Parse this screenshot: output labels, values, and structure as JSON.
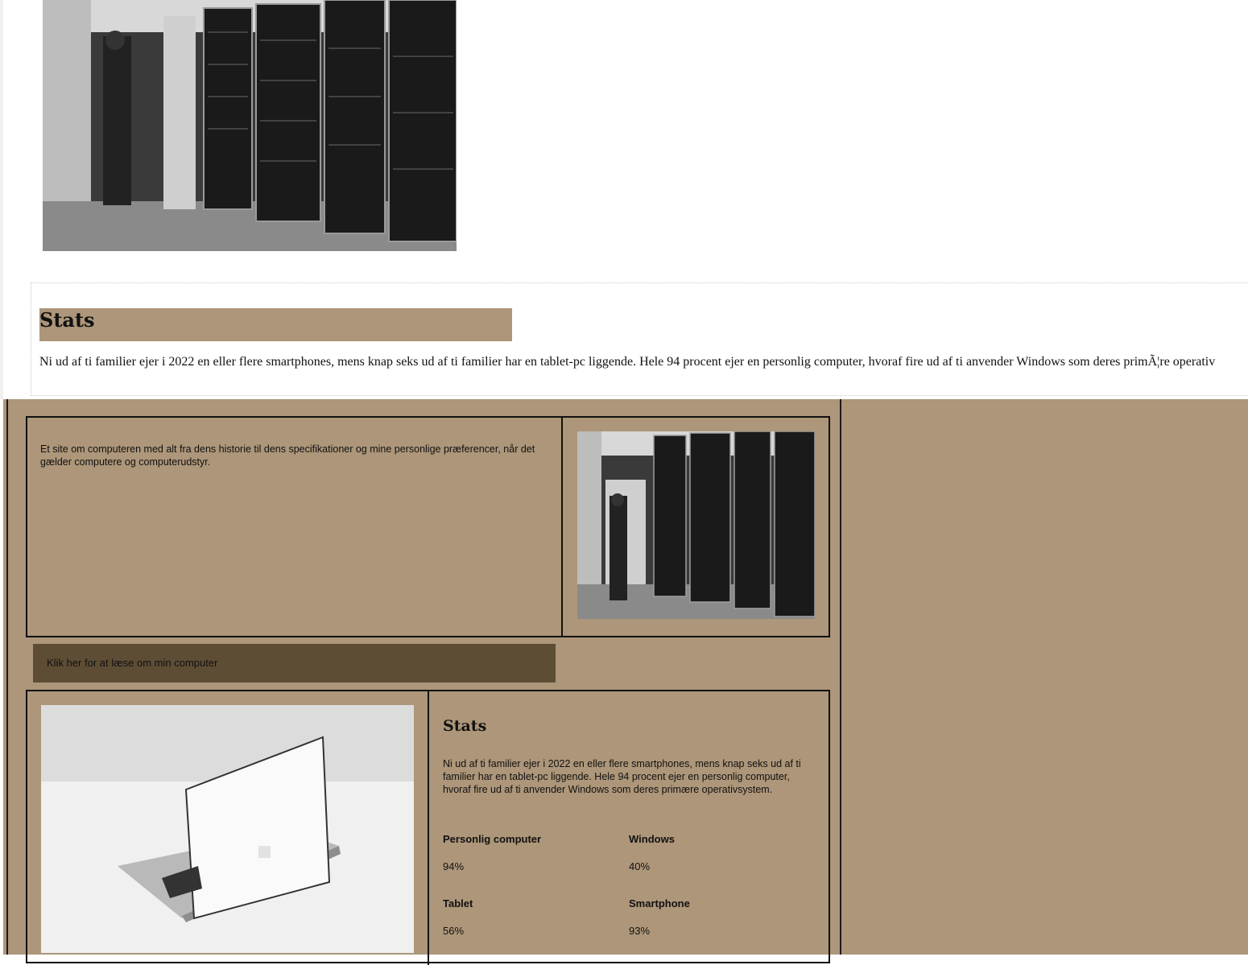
{
  "stats_section_top": {
    "heading": "Stats",
    "text": "Ni ud af ti familier ejer i 2022 en eller flere smartphones, mens knap seks ud af ti familier har en tablet-pc liggende. Hele 94 procent ejer en personlig computer, hvoraf fire ud af ti anvender Windows som deres primÃ¦re operativ"
  },
  "intro": {
    "text": "Et site om computeren med alt fra dens historie til dens specifikationer og mine personlige præferencer, når det gælder computere og computerudstyr."
  },
  "cta": {
    "label": "Klik her for at læse om min computer"
  },
  "stats": {
    "heading": "Stats",
    "text": "Ni ud af ti familier ejer i 2022 en eller flere smartphones, mens knap seks ud af ti familier har en tablet-pc liggende. Hele 94 procent ejer en personlig computer, hvoraf fire ud af ti anvender Windows som deres primære operativsystem.",
    "items": [
      {
        "label": "Personlig computer",
        "value": "94%"
      },
      {
        "label": "Windows",
        "value": "40%"
      },
      {
        "label": "Tablet",
        "value": "56%"
      },
      {
        "label": "Smartphone",
        "value": "93%"
      }
    ]
  },
  "colors": {
    "tan_background": "#ad9679",
    "button_brown": "#5e4d35"
  }
}
